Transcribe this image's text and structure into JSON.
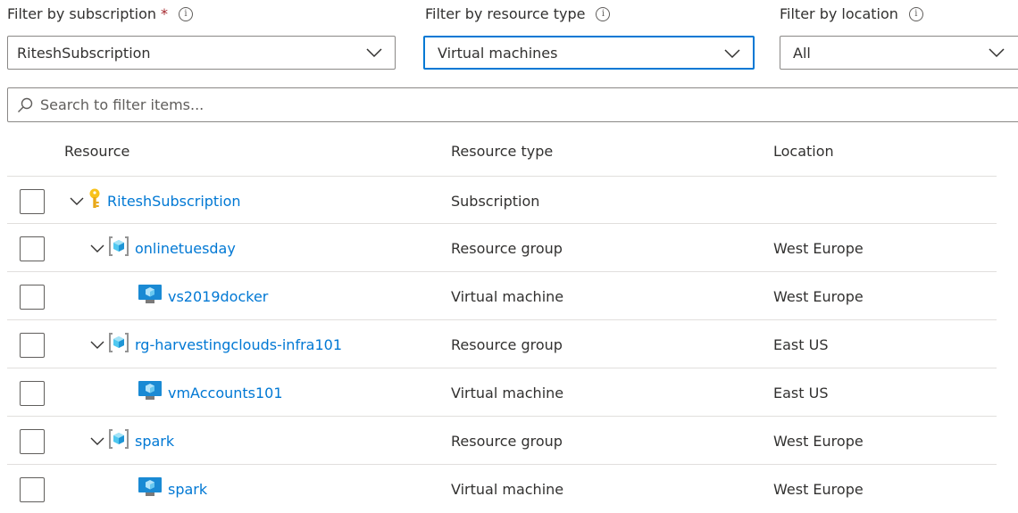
{
  "filters": {
    "subscription": {
      "label": "Filter by subscription",
      "required_mark": "*",
      "value": "RiteshSubscription"
    },
    "resource_type": {
      "label": "Filter by resource type",
      "value": "Virtual machines"
    },
    "location": {
      "label": "Filter by location",
      "value": "All"
    }
  },
  "search": {
    "placeholder": "Search to filter items..."
  },
  "table": {
    "headers": {
      "resource": "Resource",
      "type": "Resource type",
      "location": "Location"
    },
    "rows": [
      {
        "name": "RiteshSubscription",
        "type": "Subscription",
        "location": "",
        "icon": "key-icon"
      },
      {
        "name": "onlinetuesday",
        "type": "Resource group",
        "location": "West Europe",
        "icon": "resource-group-icon"
      },
      {
        "name": "vs2019docker",
        "type": "Virtual machine",
        "location": "West Europe",
        "icon": "virtual-machine-icon"
      },
      {
        "name": "rg-harvestingclouds-infra101",
        "type": "Resource group",
        "location": "East US",
        "icon": "resource-group-icon"
      },
      {
        "name": "vmAccounts101",
        "type": "Virtual machine",
        "location": "East US",
        "icon": "virtual-machine-icon"
      },
      {
        "name": "spark",
        "type": "Resource group",
        "location": "West Europe",
        "icon": "resource-group-icon"
      },
      {
        "name": "spark",
        "type": "Virtual machine",
        "location": "West Europe",
        "icon": "virtual-machine-icon"
      }
    ]
  },
  "colors": {
    "link": "#0078d4",
    "focus_border": "#0078d4",
    "required": "#a4262c"
  }
}
